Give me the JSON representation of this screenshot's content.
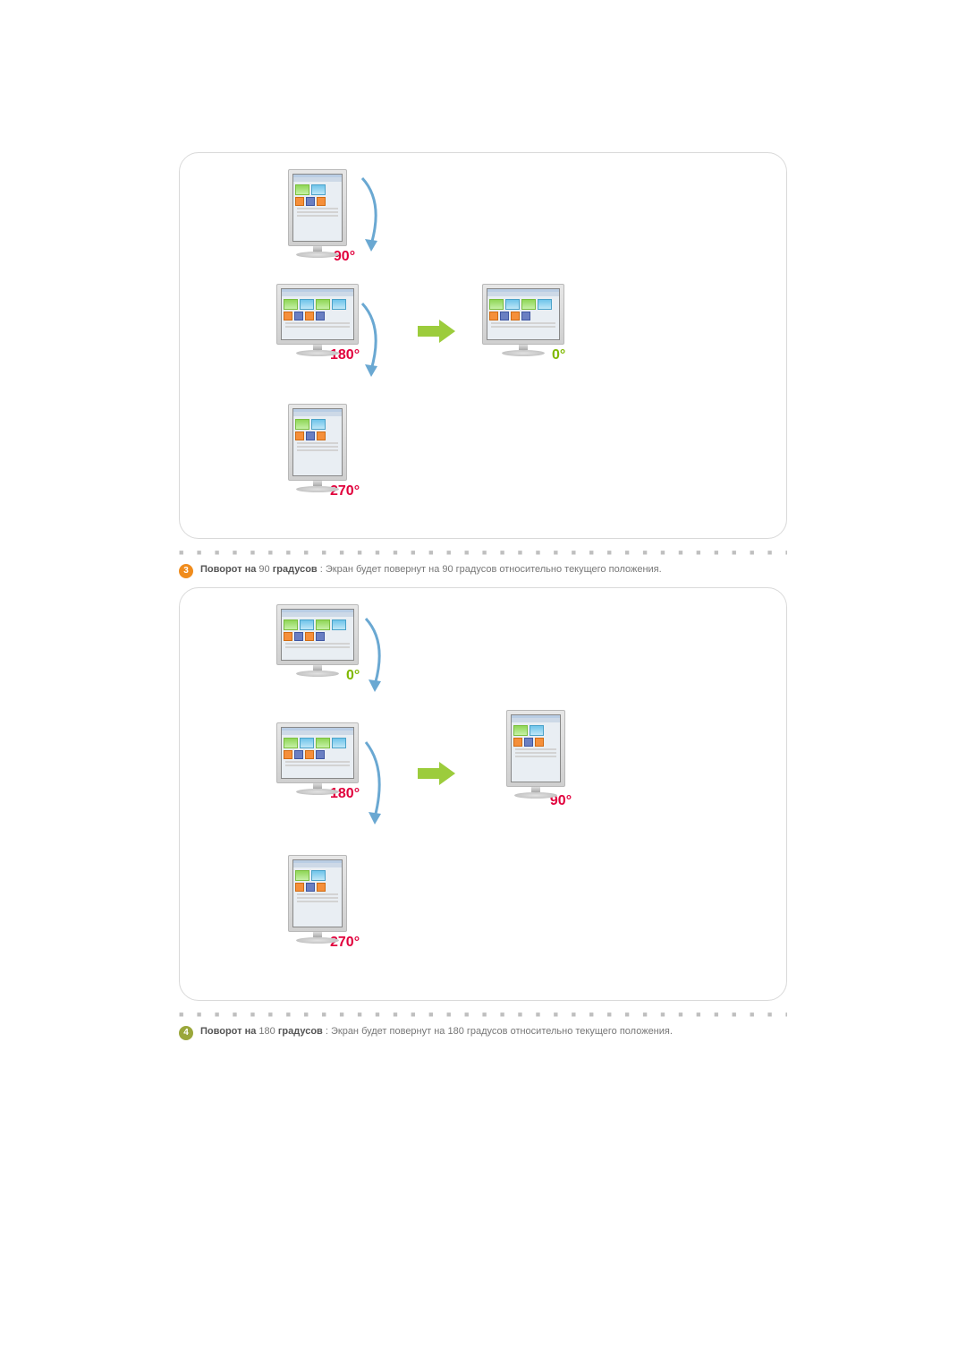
{
  "diagram1": {
    "labels": {
      "top": "90°",
      "midL": "180°",
      "midR": "0°",
      "bottom": "270°"
    }
  },
  "caption3": {
    "num": "3",
    "bold1": "Поворот на",
    "deg": "90",
    "bold2": "градусов",
    "rest": " : Экран будет повернут на 90 градусов относительно текущего положения."
  },
  "diagram2": {
    "labels": {
      "top": "0°",
      "midL": "180°",
      "midR": "90°",
      "bottom": "270°"
    }
  },
  "caption4": {
    "num": "4",
    "bold1": "Поворот на",
    "deg": "180",
    "bold2": "градусов",
    "rest": " : Экран будет повернут на 180 градусов относительно текущего положения."
  },
  "dotrow": "■ ■ ■ ■ ■ ■ ■ ■ ■ ■ ■ ■ ■ ■ ■ ■ ■ ■ ■ ■ ■ ■ ■ ■ ■ ■ ■ ■ ■ ■ ■ ■ ■ ■ ■ ■ ■ ■ ■ ■ ■ ■"
}
